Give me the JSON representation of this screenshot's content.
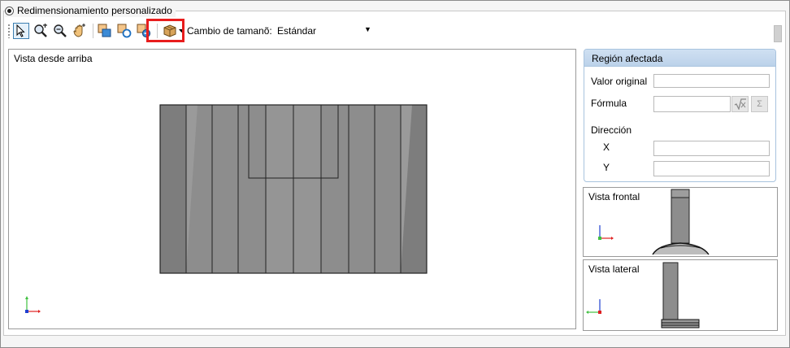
{
  "group": {
    "radio_label": "Redimensionamiento personalizado"
  },
  "toolbar": {
    "tools": [
      {
        "icon": "pointer-arrow-icon"
      },
      {
        "icon": "zoom-window-icon"
      },
      {
        "icon": "zoom-icon"
      },
      {
        "icon": "pan-hand-icon"
      },
      {
        "icon": "region-select-icon"
      },
      {
        "icon": "region-add-icon"
      },
      {
        "icon": "region-remove-icon"
      },
      {
        "icon": "box-3d-dropdown-icon"
      }
    ],
    "size_change_label": "Cambio de tamanõ:",
    "size_change_value": "Estándar"
  },
  "top_view": {
    "label": "Vista desde arriba"
  },
  "region": {
    "title": "Región afectada",
    "original_value_label": "Valor original",
    "formula_label": "Fórmula",
    "direction_label": "Dirección",
    "x_label": "X",
    "y_label": "Y",
    "sigma_symbol": "Σ"
  },
  "front_view": {
    "label": "Vista frontal"
  },
  "side_view": {
    "label": "Vista lateral"
  },
  "colors": {
    "highlight": "#e81d1d",
    "panel_header": "#c4d8ee",
    "model_gray": "#8a8a8a"
  }
}
